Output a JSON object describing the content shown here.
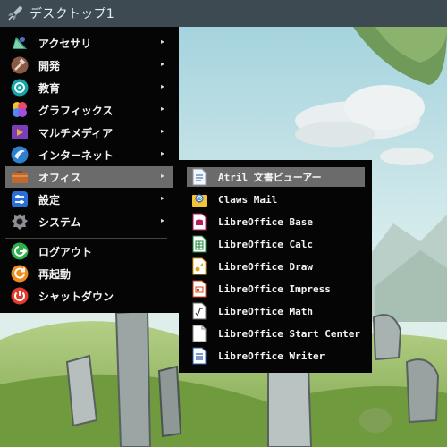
{
  "panel": {
    "workspace_label": "デスクトップ1",
    "launcher_icon": "rocket-icon"
  },
  "main_menu": {
    "items": [
      {
        "label": "アクセサリ",
        "icon": "accessories-icon",
        "has_submenu": true
      },
      {
        "label": "開発",
        "icon": "development-icon",
        "has_submenu": true
      },
      {
        "label": "教育",
        "icon": "education-icon",
        "has_submenu": true
      },
      {
        "label": "グラフィックス",
        "icon": "graphics-icon",
        "has_submenu": true
      },
      {
        "label": "マルチメディア",
        "icon": "multimedia-icon",
        "has_submenu": true
      },
      {
        "label": "インターネット",
        "icon": "internet-icon",
        "has_submenu": true
      },
      {
        "label": "オフィス",
        "icon": "office-icon",
        "has_submenu": true,
        "highlighted": true
      },
      {
        "label": "設定",
        "icon": "settings-icon",
        "has_submenu": true
      },
      {
        "label": "システム",
        "icon": "system-icon",
        "has_submenu": true
      }
    ],
    "session_items": [
      {
        "label": "ログアウト",
        "icon": "logout-icon"
      },
      {
        "label": "再起動",
        "icon": "reboot-icon"
      },
      {
        "label": "シャットダウン",
        "icon": "shutdown-icon"
      }
    ],
    "submenu_arrow": "▸"
  },
  "office_submenu": {
    "items": [
      {
        "label": "Atril 文書ビューアー",
        "icon": "document-viewer-icon",
        "highlighted": true
      },
      {
        "label": "Claws Mail",
        "icon": "mail-icon"
      },
      {
        "label": "LibreOffice Base",
        "icon": "libreoffice-base-icon"
      },
      {
        "label": "LibreOffice Calc",
        "icon": "libreoffice-calc-icon"
      },
      {
        "label": "LibreOffice Draw",
        "icon": "libreoffice-draw-icon"
      },
      {
        "label": "LibreOffice Impress",
        "icon": "libreoffice-impress-icon"
      },
      {
        "label": "LibreOffice Math",
        "icon": "libreoffice-math-icon"
      },
      {
        "label": "LibreOffice Start Center",
        "icon": "libreoffice-start-center-icon"
      },
      {
        "label": "LibreOffice Writer",
        "icon": "libreoffice-writer-icon"
      }
    ]
  },
  "colors": {
    "panel": "#3d4a52",
    "menu": "#050505",
    "highlight": "#6b6b6b"
  }
}
